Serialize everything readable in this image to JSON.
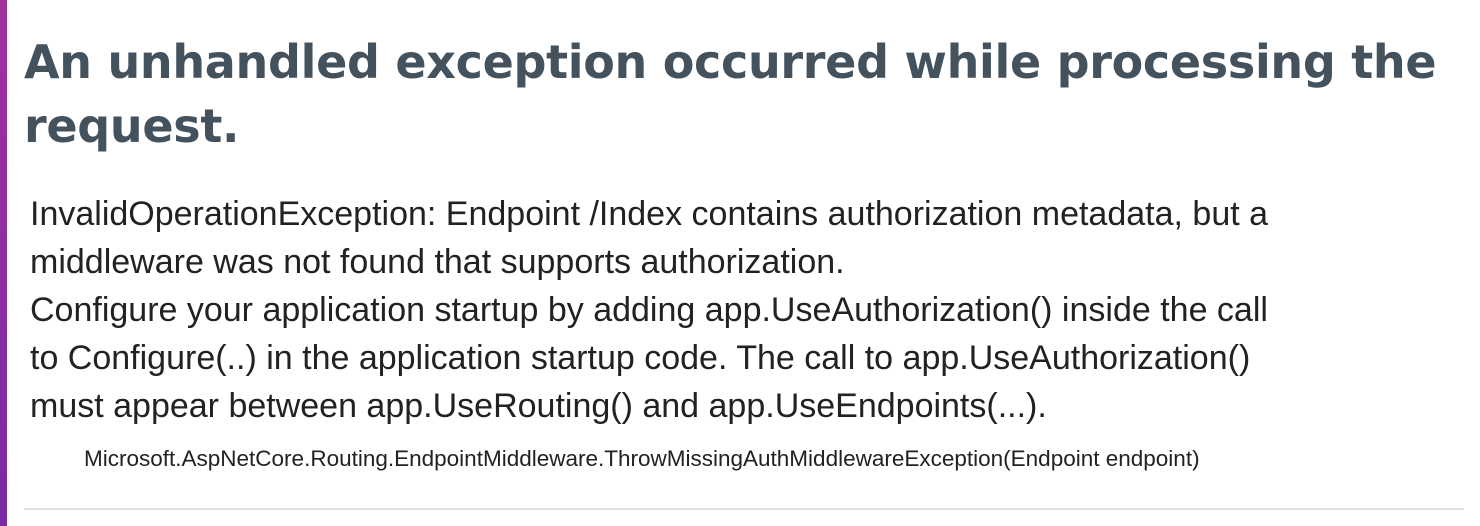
{
  "error": {
    "title": "An unhandled exception occurred while processing the request.",
    "message_lines": [
      "InvalidOperationException: Endpoint /Index contains authorization metadata, but a",
      "middleware was not found that supports authorization.",
      "Configure your application startup by adding app.UseAuthorization() inside the call",
      "to Configure(..) in the application startup code. The call to app.UseAuthorization()",
      "must appear between app.UseRouting() and app.UseEndpoints(...)."
    ],
    "stack_frame": "Microsoft.AspNetCore.Routing.EndpointMiddleware.ThrowMissingAuthMiddlewareException(Endpoint endpoint)"
  },
  "colors": {
    "title": "#44525e",
    "text": "#222222",
    "accent_bar": "#a2309f",
    "divider": "#e2e2e2"
  }
}
